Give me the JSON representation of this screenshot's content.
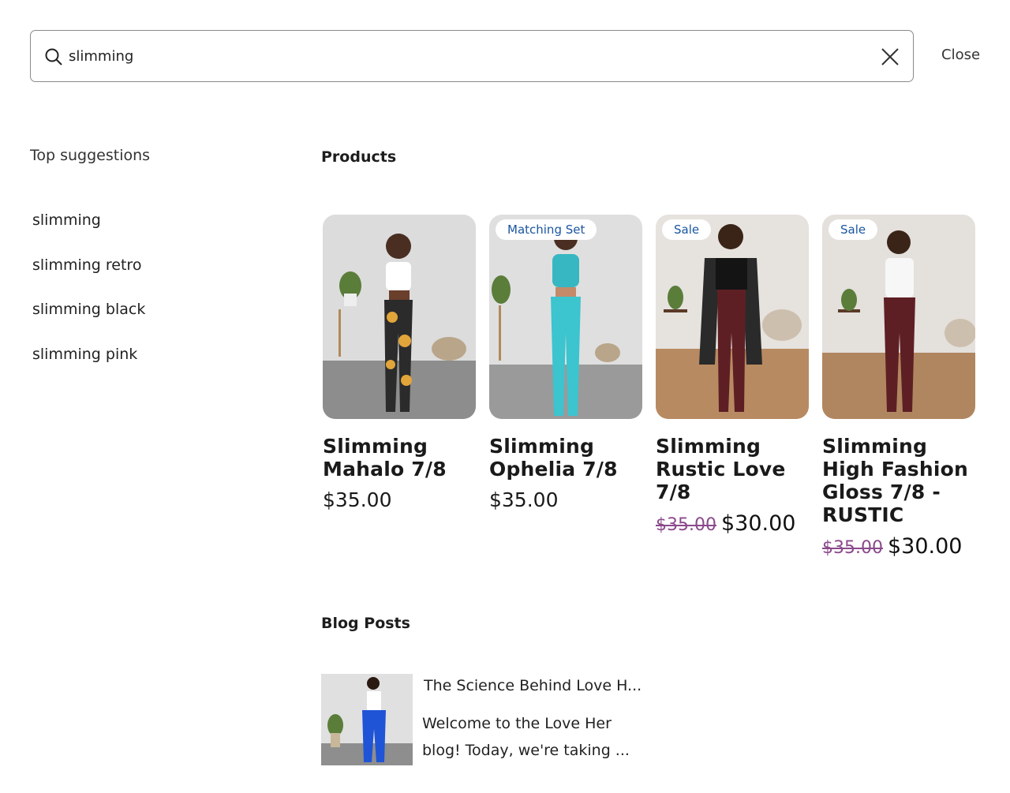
{
  "search": {
    "value": "slimming",
    "placeholder": "",
    "clear_icon": "close-icon",
    "close_label": "Close"
  },
  "suggestions": {
    "heading": "Top suggestions",
    "items": [
      "slimming",
      "slimming retro",
      "slimming black",
      "slimming pink"
    ]
  },
  "products": {
    "heading": "Products",
    "items": [
      {
        "name": "Slimming Mahalo 7/8",
        "price": "$35.00",
        "badge": "",
        "old_price": "",
        "sale_price": ""
      },
      {
        "name": "Slimming Ophelia 7/8",
        "price": "$35.00",
        "badge": "Matching Set",
        "old_price": "",
        "sale_price": ""
      },
      {
        "name": "Slimming Rustic Love 7/8",
        "price": "",
        "badge": "Sale",
        "old_price": "$35.00",
        "sale_price": "$30.00"
      },
      {
        "name": "Slimming High Fashion Gloss 7/8 - RUSTIC",
        "price": "",
        "badge": "Sale",
        "old_price": "$35.00",
        "sale_price": "$30.00"
      }
    ]
  },
  "blog": {
    "heading": "Blog Posts",
    "posts": [
      {
        "title": "The Science Behind Love H...",
        "excerpt": "Welcome to the Love Her blog! Today, we're taking ..."
      }
    ]
  },
  "colors": {
    "badge_text": "#1a56a0",
    "old_price": "#8b4a8c",
    "border": "#8a8a8a"
  }
}
